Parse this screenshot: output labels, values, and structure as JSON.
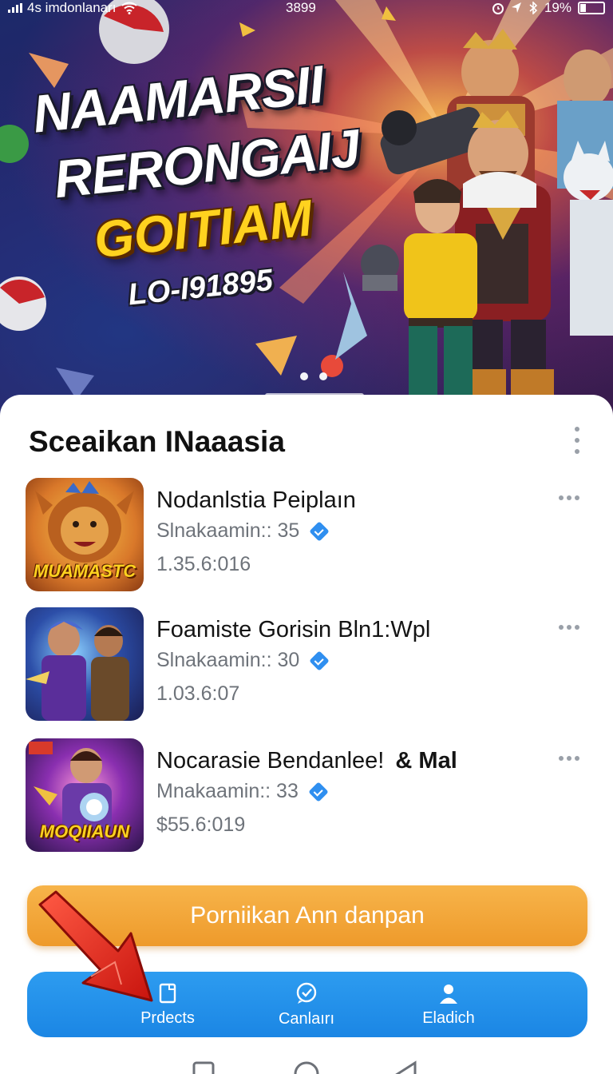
{
  "status_bar": {
    "carrier": "4s imdonlanarı",
    "time": "3899",
    "battery": "19%"
  },
  "hero": {
    "title_line1": "NAAMARSII",
    "title_line2": "RERONGAIJ",
    "title_line3": "GOITIAM",
    "title_line4": "LO-I91895",
    "page_count": 2,
    "active_page": 1
  },
  "section": {
    "title": "Sceaikan INaaasia"
  },
  "apps": [
    {
      "title": "Nodanlstia Peiplaın",
      "subtitle": "Slnakaamin:: 35",
      "meta": "1.35.6:016",
      "thumb_label": "MUAMASTC",
      "verified": true
    },
    {
      "title": "Foamiste Gorisin Bln1:Wpl",
      "subtitle": "Slnakaamin:: 30",
      "meta": "1.03.6:07",
      "thumb_label": "",
      "verified": true
    },
    {
      "title": "Nocarasie Bendanlee!",
      "title_suffix": "& Mal",
      "subtitle": "Mnakaamin:: 33",
      "meta": "$55.6:019",
      "thumb_label": "MOQIIAUN",
      "verified": true
    }
  ],
  "cta": {
    "label": "Porniikan Ann danpan"
  },
  "bottom_nav": {
    "items": [
      {
        "label": "Prdects",
        "icon": "document-icon"
      },
      {
        "label": "Canlaırı",
        "icon": "chat-check-icon"
      },
      {
        "label": "Eladich",
        "icon": "person-icon"
      }
    ]
  },
  "colors": {
    "accent_orange": "#ee9a2b",
    "nav_blue": "#1b86e4",
    "verified_blue": "#2f8ff0",
    "arrow_red": "#e8261e"
  }
}
